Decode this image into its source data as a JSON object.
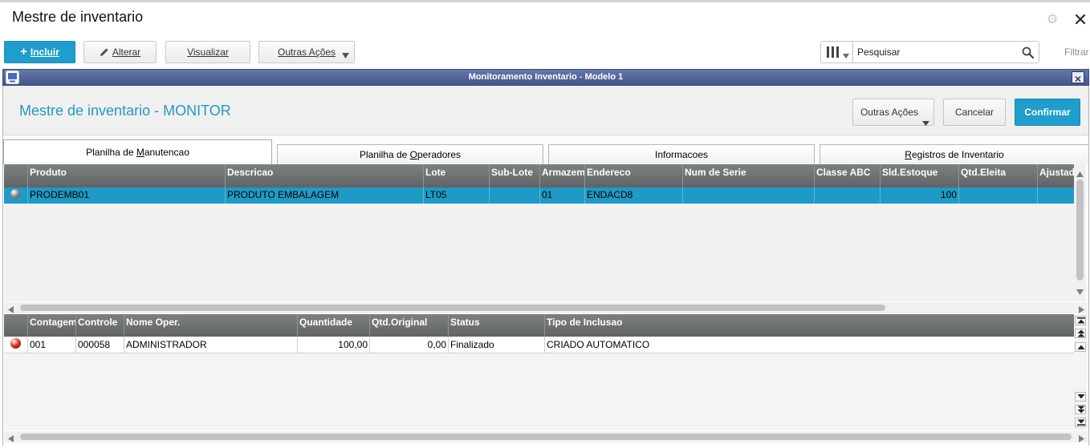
{
  "window": {
    "title": "Mestre de inventario"
  },
  "toolbar": {
    "incluir_label": "Incluir",
    "alterar_label": "Alterar",
    "visualizar_label": "Visualizar",
    "outras_acoes_label": "Outras Ações",
    "search_placeholder": "Pesquisar",
    "filtrar_label": "Filtrar"
  },
  "dialog": {
    "title": "Monitoramento Inventario - Modelo 1",
    "heading": "Mestre de inventario - MONITOR",
    "outras_acoes_label": "Outras Ações",
    "cancelar_label": "Cancelar",
    "confirmar_label": "Confirmar",
    "tabs": [
      {
        "label": "Planilha de Manutencao",
        "accel": "M",
        "active": true
      },
      {
        "label": "Planilha de Operadores",
        "accel": "O",
        "active": false
      },
      {
        "label": "Informacoes",
        "accel": "",
        "active": false
      },
      {
        "label": "Registros de Inventario",
        "accel": "R",
        "active": false
      }
    ]
  },
  "grid_produtos": {
    "columns": [
      "Produto",
      "Descricao",
      "Lote",
      "Sub-Lote",
      "Armazem",
      "Endereco",
      "Num de Serie",
      "Classe ABC",
      "Sld.Estoque",
      "Qtd.Eleita",
      "Ajustad"
    ],
    "rows": [
      {
        "selected": true,
        "status_color": "#8c8c8c",
        "produto": "PRODEMB01",
        "descricao": "PRODUTO EMBALAGEM",
        "lote": "LT05",
        "sub_lote": "",
        "armazem": "01",
        "endereco": "ENDACD8",
        "num_serie": "",
        "classe_abc": "",
        "sld_estoque": "100",
        "qtd_eleita": "",
        "ajustado": ""
      }
    ]
  },
  "grid_contagens": {
    "columns": [
      "Contagem",
      "Controle",
      "Nome Oper.",
      "Quantidade",
      "Qtd.Original",
      "Status",
      "Tipo de Inclusao"
    ],
    "rows": [
      {
        "status_color": "#e0281a",
        "contagem": "001",
        "controle": "000058",
        "nome_oper": "ADMINISTRADOR",
        "quantidade": "100,00",
        "qtd_original": "0,00",
        "status": "Finalizado",
        "tipo_inclusao": "CRIADO AUTOMATICO"
      }
    ]
  },
  "icons": {
    "window_settings": "gear-icon",
    "window_close": "close-icon",
    "incluir": "plus-icon",
    "alterar": "pencil-icon",
    "dropdown": "chevron-down-icon",
    "search_columns": "columns-icon",
    "search": "search-icon",
    "dialog": "window-icon"
  },
  "colors": {
    "accent": "#1f9dcc",
    "heading": "#2398c6",
    "dialog_title_bar": "#4d619a",
    "grid_header": "#6e7273",
    "selected_row": "#1e9ac6"
  }
}
